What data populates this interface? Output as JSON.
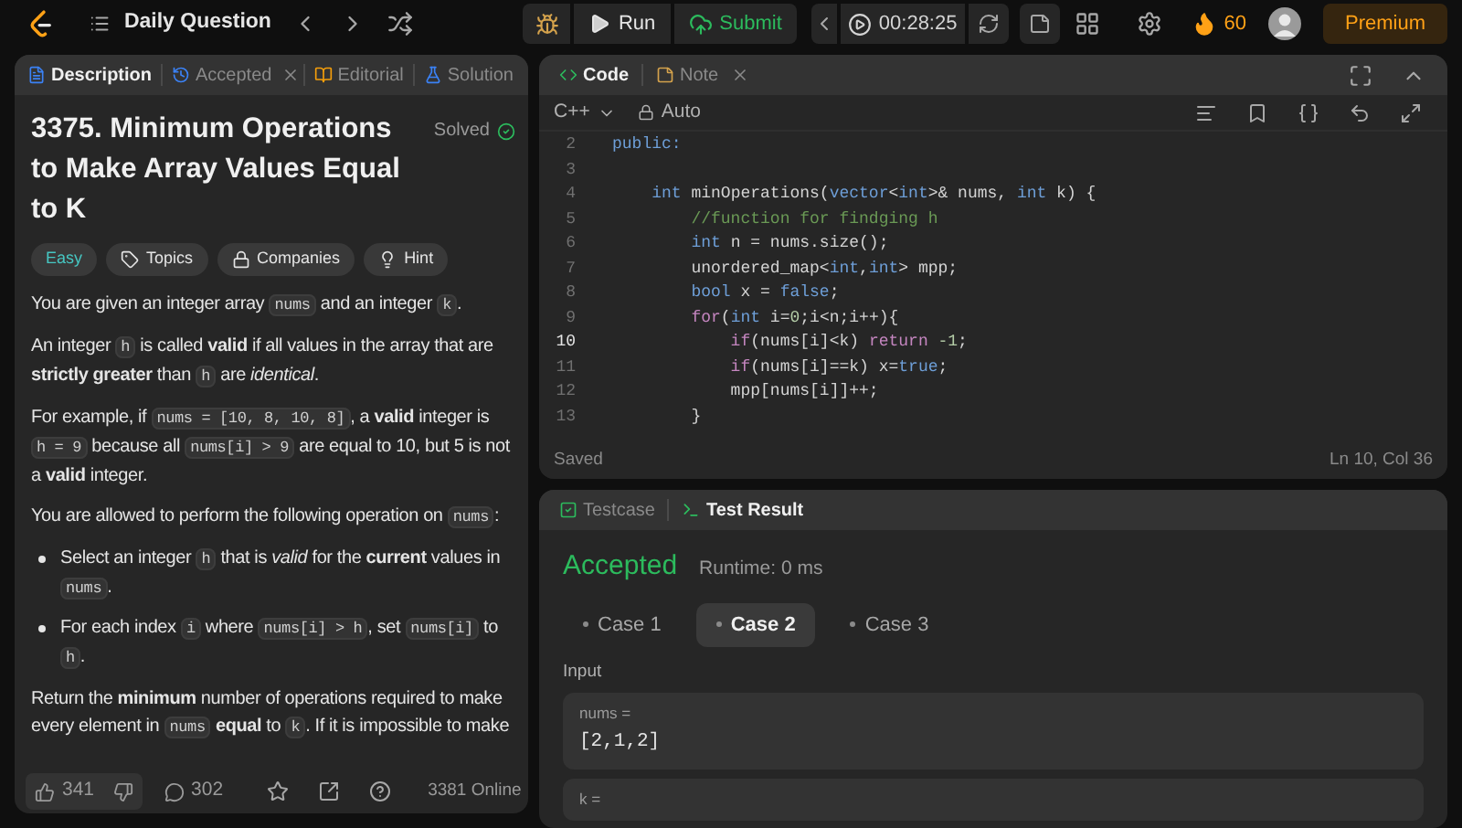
{
  "header": {
    "title": "Daily Question",
    "run": "Run",
    "submit": "Submit",
    "timer": "00:28:25",
    "streak": "60",
    "premium": "Premium"
  },
  "description_panel": {
    "tabs": [
      {
        "label": "Description",
        "selected": true,
        "closable": false
      },
      {
        "label": "Accepted",
        "selected": false,
        "closable": true
      },
      {
        "label": "Editorial",
        "selected": false,
        "closable": false
      },
      {
        "label": "Solution",
        "selected": false,
        "closable": false
      }
    ],
    "problem": {
      "title": "3375. Minimum Operations to Make Array Values Equal to K",
      "status": "Solved",
      "tags": [
        {
          "label": "Easy",
          "kind": "difficulty"
        },
        {
          "label": "Topics",
          "kind": "topics"
        },
        {
          "label": "Companies",
          "kind": "companies"
        },
        {
          "label": "Hint",
          "kind": "hint"
        }
      ]
    },
    "content": [
      {
        "kind": "paragraph",
        "segments": [
          {
            "kind": "text",
            "text": "You are given an integer array "
          },
          {
            "kind": "code",
            "text": "nums"
          },
          {
            "kind": "text",
            "text": " and an integer "
          },
          {
            "kind": "code",
            "text": "k"
          },
          {
            "kind": "text",
            "text": "."
          }
        ]
      },
      {
        "kind": "paragraph",
        "segments": [
          {
            "kind": "text",
            "text": "An integer "
          },
          {
            "kind": "code",
            "text": "h"
          },
          {
            "kind": "text",
            "text": " is called **valid** if all values in the array that are **strictly greater** than "
          },
          {
            "kind": "code",
            "text": "h"
          },
          {
            "kind": "text",
            "text": " are *identical*."
          }
        ]
      },
      {
        "kind": "paragraph",
        "segments": [
          {
            "kind": "text",
            "text": "For example, if "
          },
          {
            "kind": "code",
            "text": "nums = [10, 8, 10, 8]"
          },
          {
            "kind": "text",
            "text": ", a **valid** integer is "
          },
          {
            "kind": "code",
            "text": "h = 9"
          },
          {
            "kind": "text",
            "text": " because all "
          },
          {
            "kind": "code",
            "text": "nums[i] > 9"
          },
          {
            "kind": "text",
            "text": " are equal to 10, but 5 is not a **valid** integer."
          }
        ]
      },
      {
        "kind": "paragraph",
        "segments": [
          {
            "kind": "text",
            "text": "You are allowed to perform the following operation on "
          },
          {
            "kind": "code",
            "text": "nums"
          },
          {
            "kind": "text",
            "text": ":"
          }
        ]
      },
      {
        "kind": "bullets",
        "items": [
          [
            {
              "kind": "text",
              "text": "Select an integer "
            },
            {
              "kind": "code",
              "text": "h"
            },
            {
              "kind": "text",
              "text": " that is *valid* for the **current** values in "
            },
            {
              "kind": "code",
              "text": "nums"
            },
            {
              "kind": "text",
              "text": "."
            }
          ],
          [
            {
              "kind": "text",
              "text": "For each index "
            },
            {
              "kind": "code",
              "text": "i"
            },
            {
              "kind": "text",
              "text": " where "
            },
            {
              "kind": "code",
              "text": "nums[i] > h"
            },
            {
              "kind": "text",
              "text": ", set "
            },
            {
              "kind": "code",
              "text": "nums[i]"
            },
            {
              "kind": "text",
              "text": " to "
            },
            {
              "kind": "code",
              "text": "h"
            },
            {
              "kind": "text",
              "text": "."
            }
          ]
        ]
      },
      {
        "kind": "paragraph",
        "segments": [
          {
            "kind": "text",
            "text": "Return the **minimum** number of operations required to make every element in "
          },
          {
            "kind": "code",
            "text": "nums"
          },
          {
            "kind": "text",
            "text": " **equal** to "
          },
          {
            "kind": "code",
            "text": "k"
          },
          {
            "kind": "text",
            "text": ". If it is impossible to make"
          }
        ]
      }
    ],
    "footer": {
      "likes": "341",
      "comments": "302",
      "online": "3381 Online"
    }
  },
  "editor": {
    "tabs": [
      {
        "label": "Code",
        "selected": true,
        "closable": false
      },
      {
        "label": "Note",
        "selected": false,
        "closable": true
      }
    ],
    "language": "C++",
    "mode": "Auto",
    "lines": [
      {
        "number": "2",
        "current": false,
        "tokens": [
          {
            "kind": "keyword",
            "text": "public:"
          }
        ]
      },
      {
        "number": "3",
        "current": false
      },
      {
        "number": "4",
        "current": false,
        "tokens": [
          {
            "kind": "keyword",
            "text": "    int"
          },
          {
            "kind": "plain",
            "text": " minOperations("
          },
          {
            "kind": "keyword",
            "text": "vector"
          },
          {
            "kind": "plain",
            "text": "<"
          },
          {
            "kind": "keyword",
            "text": "int"
          },
          {
            "kind": "plain",
            "text": ">& nums, "
          },
          {
            "kind": "keyword",
            "text": "int"
          },
          {
            "kind": "plain",
            "text": " k) {"
          }
        ]
      },
      {
        "number": "5",
        "current": false,
        "tokens": [
          {
            "kind": "comment",
            "text": "        //function for findging h"
          }
        ]
      },
      {
        "number": "6",
        "current": false,
        "tokens": [
          {
            "kind": "keyword",
            "text": "        int"
          },
          {
            "kind": "plain",
            "text": " n = nums.size();"
          }
        ]
      },
      {
        "number": "7",
        "current": false,
        "tokens": [
          {
            "kind": "plain",
            "text": "        unordered_map<"
          },
          {
            "kind": "keyword",
            "text": "int"
          },
          {
            "kind": "plain",
            "text": ","
          },
          {
            "kind": "keyword",
            "text": "int"
          },
          {
            "kind": "plain",
            "text": "> mpp;"
          }
        ]
      },
      {
        "number": "8",
        "current": false,
        "tokens": [
          {
            "kind": "keyword",
            "text": "        bool"
          },
          {
            "kind": "plain",
            "text": " x = "
          },
          {
            "kind": "keyword",
            "text": "false"
          },
          {
            "kind": "plain",
            "text": ";"
          }
        ]
      },
      {
        "number": "9",
        "current": false,
        "tokens": [
          {
            "kind": "control",
            "text": "        for"
          },
          {
            "kind": "plain",
            "text": "("
          },
          {
            "kind": "keyword",
            "text": "int"
          },
          {
            "kind": "plain",
            "text": " i="
          },
          {
            "kind": "number",
            "text": "0"
          },
          {
            "kind": "plain",
            "text": ";i<n;i++){"
          }
        ]
      },
      {
        "number": "10",
        "current": true,
        "tokens": [
          {
            "kind": "control",
            "text": "            if"
          },
          {
            "kind": "plain",
            "text": "(nums[i]<k) "
          },
          {
            "kind": "control",
            "text": "return"
          },
          {
            "kind": "number",
            "text": " -1"
          },
          {
            "kind": "plain",
            "text": ";"
          }
        ]
      },
      {
        "number": "11",
        "current": false,
        "tokens": [
          {
            "kind": "control",
            "text": "            if"
          },
          {
            "kind": "plain",
            "text": "(nums[i]==k) x="
          },
          {
            "kind": "keyword",
            "text": "true"
          },
          {
            "kind": "plain",
            "text": ";"
          }
        ]
      },
      {
        "number": "12",
        "current": false,
        "tokens": [
          {
            "kind": "plain",
            "text": "            mpp[nums[i]]++;"
          }
        ]
      },
      {
        "number": "13",
        "current": false,
        "tokens": [
          {
            "kind": "plain",
            "text": "        }"
          }
        ]
      }
    ],
    "status": "Saved",
    "cursor": "Ln 10, Col 36"
  },
  "results": {
    "tabs": [
      {
        "label": "Testcase",
        "selected": false
      },
      {
        "label": "Test Result",
        "selected": true
      }
    ],
    "verdict": "Accepted",
    "runtime": "Runtime: 0 ms",
    "cases": [
      {
        "label": "Case 1",
        "selected": false
      },
      {
        "label": "Case 2",
        "selected": true
      },
      {
        "label": "Case 3",
        "selected": false
      }
    ],
    "input_label": "Input",
    "inputs": [
      {
        "name": "nums =",
        "value": "[2,1,2]"
      },
      {
        "name": "k ="
      }
    ]
  }
}
